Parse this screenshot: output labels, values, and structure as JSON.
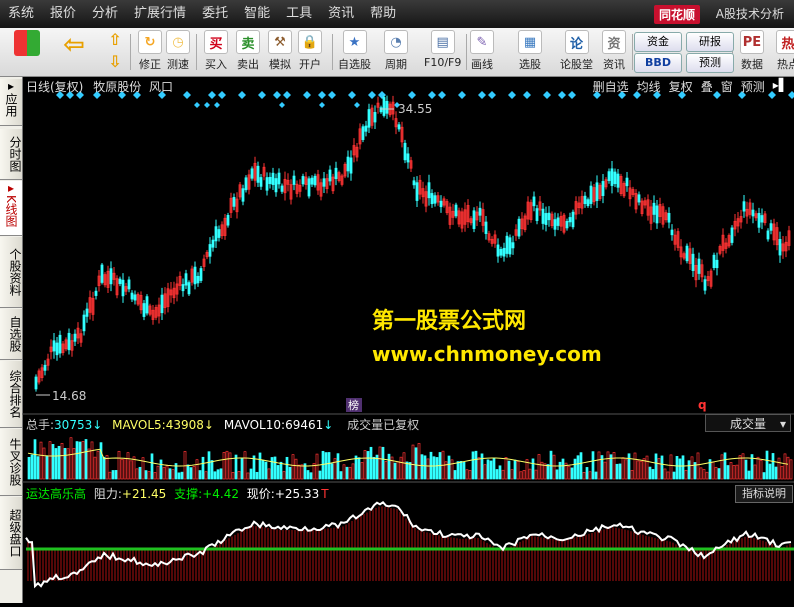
{
  "menu": [
    "系统",
    "报价",
    "分析",
    "扩展行情",
    "委托",
    "智能",
    "工具",
    "资讯",
    "帮助"
  ],
  "brand": "同花顺",
  "app_title": "A股技术分析",
  "toolbar": [
    {
      "label": "修正",
      "icon": "refresh-icon",
      "color": "#f5a623",
      "glyph": "↻"
    },
    {
      "label": "测速",
      "icon": "clock-icon",
      "color": "#f2c14e",
      "glyph": "◷"
    },
    {
      "label": "买入",
      "icon": "buy-icon",
      "color": "#d0021b",
      "glyph": "买"
    },
    {
      "label": "卖出",
      "icon": "sell-icon",
      "color": "#2a8f2a",
      "glyph": "卖"
    },
    {
      "label": "模拟",
      "icon": "hammer-icon",
      "color": "#8b5a2b",
      "glyph": "⚒"
    },
    {
      "label": "开户",
      "icon": "lock-icon",
      "color": "#c9a227",
      "glyph": "🔒"
    },
    {
      "label": "自选股",
      "icon": "star-folder-icon",
      "color": "#3b73c4",
      "glyph": "★"
    },
    {
      "label": "周期",
      "icon": "period-clock-icon",
      "color": "#5a7fb0",
      "glyph": "◔"
    },
    {
      "label": "F10/F9",
      "icon": "f10-icon",
      "color": "#4a6fa5",
      "glyph": "▤"
    },
    {
      "label": "画线",
      "icon": "pen-icon",
      "color": "#7a5fb0",
      "glyph": "✎"
    },
    {
      "label": "选股",
      "icon": "select-icon",
      "color": "#3a7ac0",
      "glyph": "▦"
    },
    {
      "label": "论股堂",
      "icon": "forum-icon",
      "color": "#2060a8",
      "glyph": "论"
    },
    {
      "label": "资讯",
      "icon": "news-icon",
      "color": "#777",
      "glyph": "资"
    },
    {
      "label": "数据",
      "icon": "pe-icon",
      "color": "#b03030",
      "glyph": "PE"
    },
    {
      "label": "热点",
      "icon": "hot-icon",
      "color": "#c02020",
      "glyph": "热"
    }
  ],
  "pills": [
    "资金",
    "研报",
    "BBD",
    "预测"
  ],
  "sidebar": [
    "应用",
    "分时图",
    "K线图",
    "个股资料",
    "自选股",
    "综合排名",
    "牛叉诊股",
    "超级盘口"
  ],
  "chart": {
    "mode": "日线(复权)",
    "stock": "牧原股份",
    "tag": "风口",
    "actions": [
      "删自选",
      "均线",
      "复权",
      "叠",
      "窗",
      "预测"
    ],
    "high_label": "34.55",
    "low_label": "14.68",
    "marker": "榜",
    "q_marker": "q"
  },
  "watermark": {
    "line1": "第一股票公式网",
    "line2": "www.chnmoney.com"
  },
  "volume": {
    "label": "总手:",
    "value": "30753",
    "ma5_label": "MAVOL5:",
    "ma5": "43908",
    "ma10_label": "MAVOL10:",
    "ma10": "69461",
    "note": "成交量已复权",
    "select": "成交量"
  },
  "indicator": {
    "name": "运达高乐高",
    "r_label": "阻力:",
    "r": "+21.45",
    "s_label": "支撑:",
    "s": "+4.42",
    "p_label": "现价:",
    "p": "+25.33",
    "button": "指标说明"
  },
  "colors": {
    "up": "#ff3333",
    "down": "#33ffff",
    "accent": "#ffe800",
    "support": "#20c020"
  }
}
